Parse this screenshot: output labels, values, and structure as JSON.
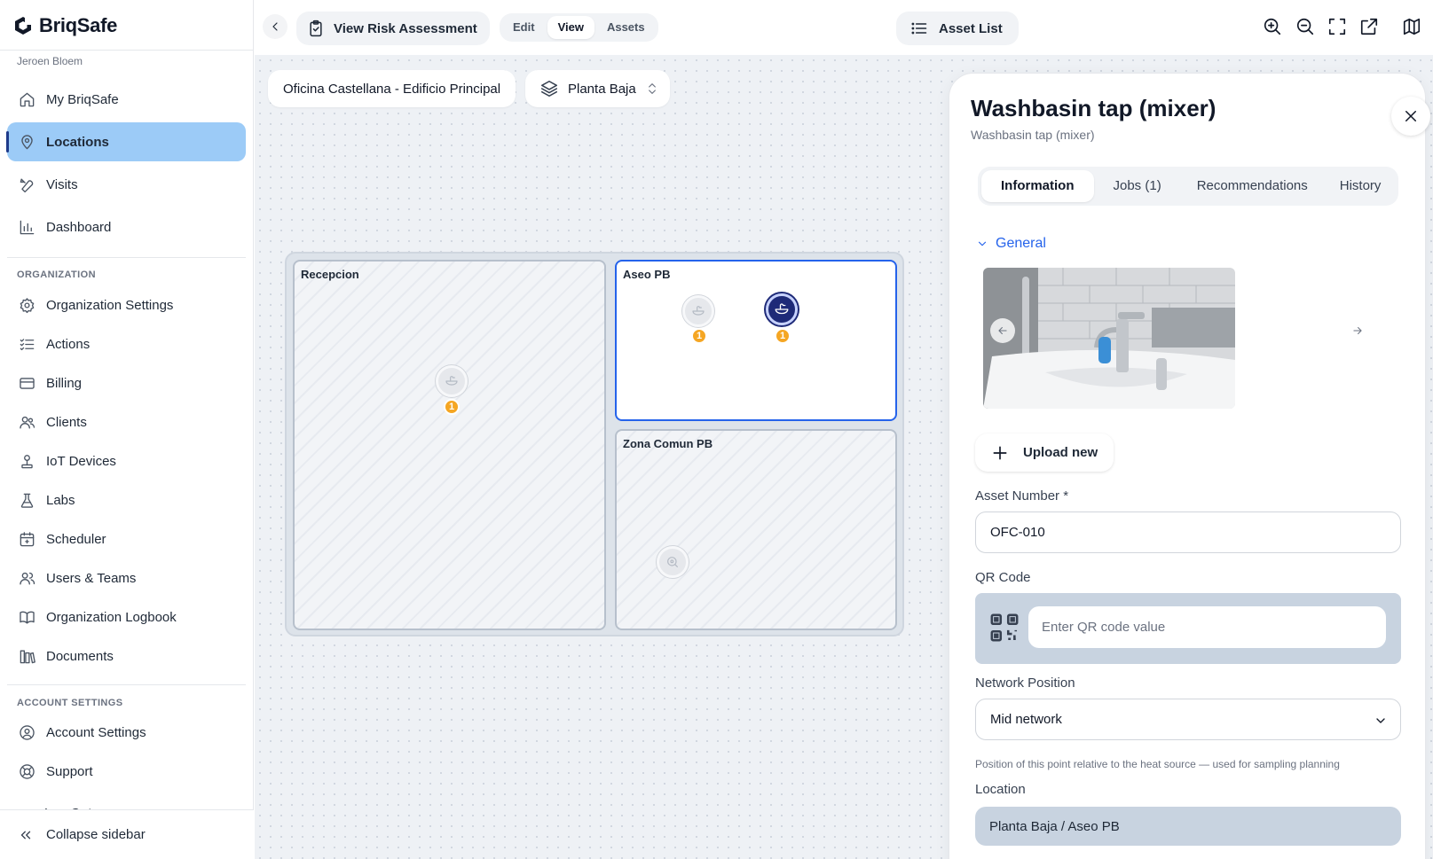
{
  "app": {
    "brand": "BriqSafe"
  },
  "user": {
    "name": "Jeroen Bloem"
  },
  "nav": {
    "my_briqsafe": "My BriqSafe",
    "locations": "Locations",
    "visits": "Visits",
    "dashboard": "Dashboard"
  },
  "organization": {
    "heading": "ORGANIZATION",
    "items": [
      "Organization Settings",
      "Actions",
      "Billing",
      "Clients",
      "IoT Devices",
      "Labs",
      "Scheduler",
      "Users & Teams",
      "Organization Logbook",
      "Documents"
    ]
  },
  "account": {
    "heading": "ACCOUNT SETTINGS",
    "items": [
      "Account Settings",
      "Support",
      "Log Out"
    ]
  },
  "sidebar_footer": {
    "collapse": "Collapse sidebar"
  },
  "toolbar": {
    "title": "View Risk Assessment",
    "modes": [
      "Edit",
      "View",
      "Assets"
    ],
    "active_mode": "View",
    "asset_list": "Asset List"
  },
  "breadcrumb": {
    "building": "Oficina Castellana - Edificio Principal",
    "floor": "Planta Baja"
  },
  "floorplan": {
    "rooms": [
      {
        "name": "Recepcion",
        "assets": [
          {
            "count": "1",
            "type": "washbasin-icon",
            "active": false
          }
        ]
      },
      {
        "name": "Aseo PB",
        "assets": [
          {
            "count": "1",
            "type": "washbasin-icon",
            "active": false
          },
          {
            "count": "1",
            "type": "washbasin-icon",
            "active": true
          }
        ]
      },
      {
        "name": "Zona Comun PB",
        "assets": [
          {
            "count": "",
            "type": "search-point-icon",
            "active": false
          }
        ]
      }
    ]
  },
  "panel": {
    "title": "Washbasin tap (mixer)",
    "subtitle": "Washbasin tap (mixer)",
    "tabs": [
      "Information",
      "Jobs (1)",
      "Recommendations",
      "History"
    ],
    "active_tab": "Information",
    "section": "General",
    "upload_label": "Upload new",
    "asset_number_label": "Asset Number *",
    "asset_number": "OFC-010",
    "qr_label": "QR Code",
    "qr_placeholder": "Enter QR code value",
    "network_label": "Network Position",
    "network_value": "Mid network",
    "network_hint": "Position of this point relative to the heat source — used for sampling planning",
    "location_label": "Location",
    "location_value": "Planta Baja / Aseo PB"
  },
  "colors": {
    "active_nav": "#9ccbf7",
    "selected_room_border": "#2563eb",
    "active_marker": "#1e2a78",
    "badge": "#f5a623",
    "link": "#2563eb"
  }
}
